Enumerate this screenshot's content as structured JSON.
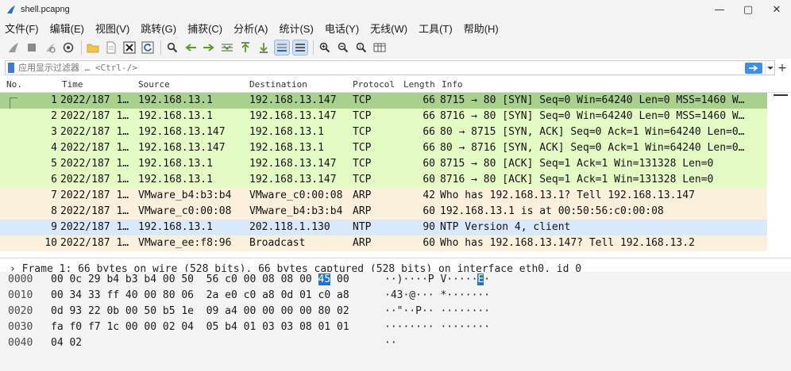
{
  "window": {
    "title": "shell.pcapng",
    "controls": [
      "—",
      "▢",
      "✕"
    ]
  },
  "menu": [
    "文件(F)",
    "编辑(E)",
    "视图(V)",
    "跳转(G)",
    "捕获(C)",
    "分析(A)",
    "统计(S)",
    "电话(Y)",
    "无线(W)",
    "工具(T)",
    "帮助(H)"
  ],
  "toolbar": {
    "icons": [
      "shark-fin-icon",
      "stop-icon",
      "restart-icon",
      "options-icon",
      "open-folder-icon",
      "file-icon",
      "close-file-icon",
      "reload-icon",
      "find-icon",
      "back-icon",
      "forward-icon",
      "go-to-packet-icon",
      "first-packet-icon",
      "last-packet-icon",
      "autoscroll-icon",
      "colorize-icon",
      "zoom-in-icon",
      "zoom-out-icon",
      "normal-size-icon",
      "resize-columns-icon"
    ]
  },
  "filter": {
    "placeholder": "应用显示过滤器 … <Ctrl-/>",
    "plus": "+"
  },
  "packet_list": {
    "headers": {
      "no": "No.",
      "time": "Time",
      "source": "Source",
      "destination": "Destination",
      "protocol": "Protocol",
      "length": "Length",
      "info": "Info"
    },
    "rows": [
      {
        "no": "1",
        "time": "2022/187 1…",
        "source": "192.168.13.1",
        "destination": "192.168.13.147",
        "protocol": "TCP",
        "length": "66",
        "info": "8715 → 80 [SYN] Seq=0 Win=64240 Len=0 MSS=1460 W…",
        "bg": "#a9d18e"
      },
      {
        "no": "2",
        "time": "2022/187 1…",
        "source": "192.168.13.1",
        "destination": "192.168.13.147",
        "protocol": "TCP",
        "length": "66",
        "info": "8716 → 80 [SYN] Seq=0 Win=64240 Len=0 MSS=1460 W…",
        "bg": "#e4fcc4"
      },
      {
        "no": "3",
        "time": "2022/187 1…",
        "source": "192.168.13.147",
        "destination": "192.168.13.1",
        "protocol": "TCP",
        "length": "66",
        "info": "80 → 8715 [SYN, ACK] Seq=0 Ack=1 Win=64240 Len=0…",
        "bg": "#e4fcc4"
      },
      {
        "no": "4",
        "time": "2022/187 1…",
        "source": "192.168.13.147",
        "destination": "192.168.13.1",
        "protocol": "TCP",
        "length": "66",
        "info": "80 → 8716 [SYN, ACK] Seq=0 Ack=1 Win=64240 Len=0…",
        "bg": "#e4fcc4"
      },
      {
        "no": "5",
        "time": "2022/187 1…",
        "source": "192.168.13.1",
        "destination": "192.168.13.147",
        "protocol": "TCP",
        "length": "60",
        "info": "8715 → 80 [ACK] Seq=1 Ack=1 Win=131328 Len=0",
        "bg": "#e4fcc4"
      },
      {
        "no": "6",
        "time": "2022/187 1…",
        "source": "192.168.13.1",
        "destination": "192.168.13.147",
        "protocol": "TCP",
        "length": "60",
        "info": "8716 → 80 [ACK] Seq=1 Ack=1 Win=131328 Len=0",
        "bg": "#e4fcc4"
      },
      {
        "no": "7",
        "time": "2022/187 1…",
        "source": "VMware_b4:b3:b4",
        "destination": "VMware_c0:00:08",
        "protocol": "ARP",
        "length": "42",
        "info": "Who has 192.168.13.1? Tell 192.168.13.147",
        "bg": "#faf0dc"
      },
      {
        "no": "8",
        "time": "2022/187 1…",
        "source": "VMware_c0:00:08",
        "destination": "VMware_b4:b3:b4",
        "protocol": "ARP",
        "length": "60",
        "info": "192.168.13.1 is at 00:50:56:c0:00:08",
        "bg": "#faf0dc"
      },
      {
        "no": "9",
        "time": "2022/187 1…",
        "source": "192.168.13.1",
        "destination": "202.118.1.130",
        "protocol": "NTP",
        "length": "90",
        "info": "NTP Version 4, client",
        "bg": "#dae8fb"
      },
      {
        "no": "10",
        "time": "2022/187 1…",
        "source": "VMware_ee:f8:96",
        "destination": "Broadcast",
        "protocol": "ARP",
        "length": "60",
        "info": "Who has 192.168.13.147? Tell 192.168.13.2",
        "bg": "#faf0dc"
      }
    ]
  },
  "detail": {
    "text": "› Frame 1: 66 bytes on wire (528 bits), 66 bytes captured (528 bits) on interface eth0, id 0"
  },
  "bytes": [
    {
      "offset": "0000",
      "hex_a": "00 0c 29 b4 b3 b4 00 50  56 c0 00 08 08 00 ",
      "hex_hl": "45",
      "hex_b": " 00",
      "ascii_a": "··)····P V·····",
      "ascii_hl": "E",
      "ascii_b": "·"
    },
    {
      "offset": "0010",
      "hex_a": "00 34 33 ff 40 00 80 06  2a e0 c0 a8 0d 01 c0 a8",
      "hex_hl": "",
      "hex_b": "",
      "ascii_a": "·43·@··· *·······",
      "ascii_hl": "",
      "ascii_b": ""
    },
    {
      "offset": "0020",
      "hex_a": "0d 93 22 0b 00 50 b5 1e  09 a4 00 00 00 00 80 02",
      "hex_hl": "",
      "hex_b": "",
      "ascii_a": "··\"··P·· ········",
      "ascii_hl": "",
      "ascii_b": ""
    },
    {
      "offset": "0030",
      "hex_a": "fa f0 f7 1c 00 00 02 04  05 b4 01 03 03 08 01 01",
      "hex_hl": "",
      "hex_b": "",
      "ascii_a": "········ ········",
      "ascii_hl": "",
      "ascii_b": ""
    },
    {
      "offset": "0040",
      "hex_a": "04 02",
      "hex_hl": "",
      "hex_b": "",
      "ascii_a": "··",
      "ascii_hl": "",
      "ascii_b": ""
    }
  ],
  "colors": {
    "accent": "#1f6fd6",
    "tcp_selected": "#a9d18e",
    "tcp": "#e4fcc4",
    "arp": "#faf0dc",
    "udp": "#dae8fb"
  }
}
